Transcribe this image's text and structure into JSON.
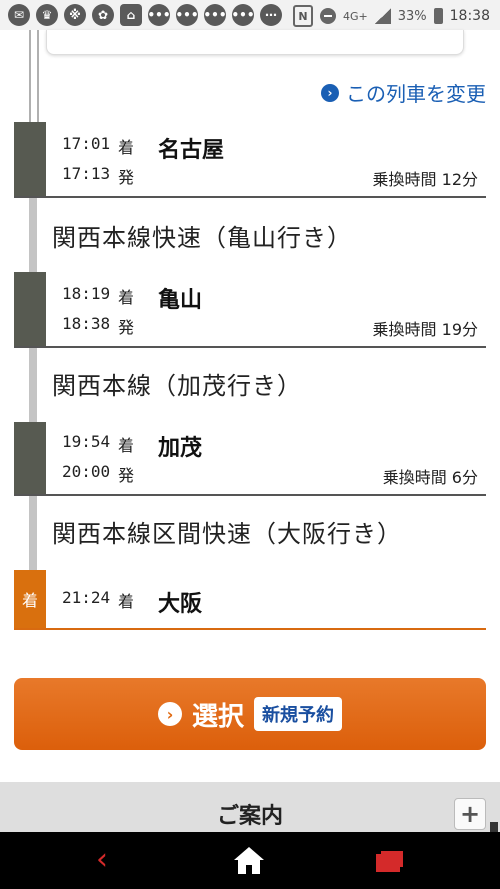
{
  "status_bar": {
    "network": "4G+",
    "battery": "33%",
    "time": "18:38"
  },
  "change_link": {
    "label": "この列車を変更"
  },
  "stations": [
    {
      "arrive": "17:01",
      "arrive_label": "着",
      "depart": "17:13",
      "depart_label": "発",
      "name": "名古屋",
      "transfer": "乗換時間 12分"
    },
    {
      "arrive": "18:19",
      "arrive_label": "着",
      "depart": "18:38",
      "depart_label": "発",
      "name": "亀山",
      "transfer": "乗換時間 19分"
    },
    {
      "arrive": "19:54",
      "arrive_label": "着",
      "depart": "20:00",
      "depart_label": "発",
      "name": "加茂",
      "transfer": "乗換時間 6分"
    },
    {
      "arrive": "21:24",
      "arrive_label": "着",
      "name": "大阪",
      "bar_label": "着"
    }
  ],
  "segments": [
    {
      "label": "関西本線快速（亀山行き）"
    },
    {
      "label": "関西本線（加茂行き）"
    },
    {
      "label": "関西本線区間快速（大阪行き）"
    }
  ],
  "select_button": {
    "label": "選択",
    "badge": "新規予約"
  },
  "guide": {
    "title": "ご案内"
  },
  "colors": {
    "accent_orange": "#dc5f0b",
    "link_blue": "#1a5fb4",
    "station_bar": "#575a51"
  }
}
